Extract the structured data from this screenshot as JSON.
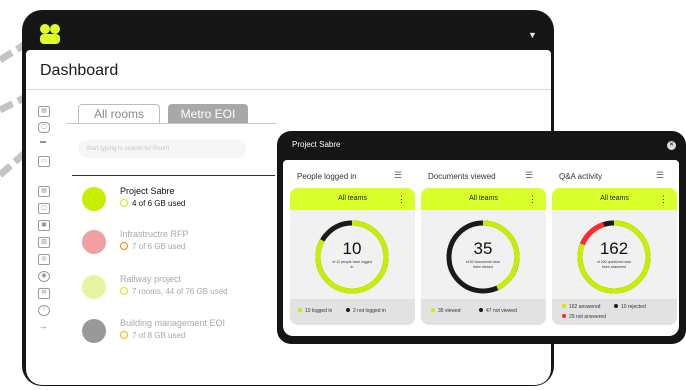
{
  "app": {
    "title": "Dashboard"
  },
  "tabs": [
    {
      "label": "All rooms",
      "active": false
    },
    {
      "label": "Metro EOI",
      "active": true
    }
  ],
  "search": {
    "placeholder": "Start typing to search for Room"
  },
  "rooms": [
    {
      "name": "Project Sabre",
      "usage": "4 of 6 GB used",
      "dot_color": "#c9ef00",
      "ring_color": "#c9ef00",
      "selected": true
    },
    {
      "name": "Infrastructre RFP",
      "usage": "7 of 6 GB used",
      "dot_color": "#f0a0a0",
      "ring_color": "#ff7a00",
      "selected": false
    },
    {
      "name": "Railway project",
      "usage": "7 rooms, 44 of 76 GB used",
      "dot_color": "#e8f4a0",
      "ring_color": "#c9ef00",
      "selected": false
    },
    {
      "name": "Building management EOI",
      "usage": "7 of 8 GB used",
      "dot_color": "#999999",
      "ring_color": "#ffb000",
      "selected": false
    }
  ],
  "nav_icons": [
    "grid-icon",
    "lock-icon",
    "image-icon",
    "list-icon",
    "note-icon",
    "page-icon",
    "copy-icon",
    "photo-icon",
    "settings-icon",
    "mail-icon",
    "info-icon",
    "arrow-right-icon"
  ],
  "popup": {
    "title": "Project Sabre",
    "panels": [
      {
        "heading": "People logged in",
        "filter": "All teams",
        "value": "10",
        "caption": "of 12 people have logged in",
        "legend": [
          {
            "label": "10 logged in",
            "color": "#c9ef00"
          },
          {
            "label": "2 not logged in",
            "color": "#1a1a1a"
          }
        ],
        "progress": 0.83,
        "arc_color": "#c9ef00"
      },
      {
        "heading": "Documents viewed",
        "filter": "All teams",
        "value": "35",
        "caption": "of 82 documents have been viewed",
        "legend": [
          {
            "label": "35 viewed",
            "color": "#c9ef00"
          },
          {
            "label": "47 not viewed",
            "color": "#1a1a1a"
          }
        ],
        "progress": 0.43,
        "arc_color": "#c9ef00"
      },
      {
        "heading": "Q&A activity",
        "filter": "All teams",
        "value": "162",
        "caption": "of 200 questions have been answered",
        "legend": [
          {
            "label": "162 answered",
            "color": "#c9ef00"
          },
          {
            "label": "10 rejected",
            "color": "#1a1a1a"
          },
          {
            "label": "29 not answered",
            "color": "#ff2a2a"
          }
        ],
        "progress": 0.81,
        "arc_color": "#c9ef00",
        "extra_color": "#ff2a2a"
      }
    ]
  },
  "colors": {
    "accent": "#d8ff2a",
    "frame": "#161616",
    "popup": "#151515"
  }
}
